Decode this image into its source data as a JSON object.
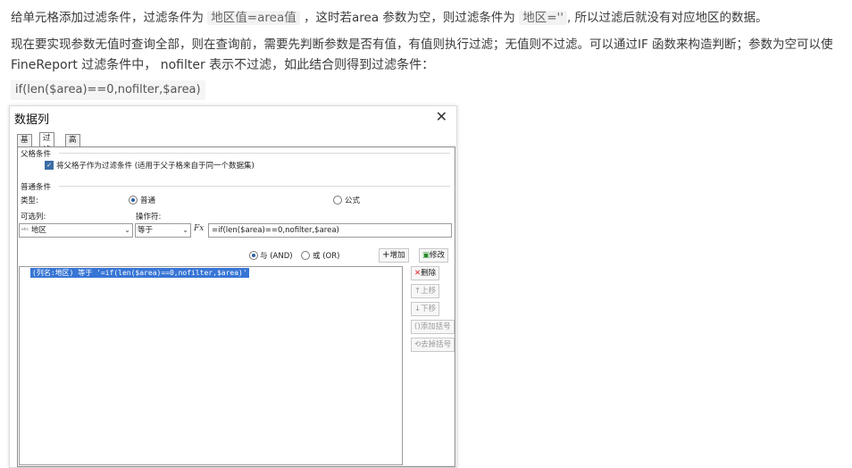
{
  "article": {
    "line1_a": "给单元格添加过滤条件，过滤条件为 ",
    "line1_code1": "地区值=area值",
    "line1_b": " ，这时若area 参数为空，则过滤条件为 ",
    "line1_code2": "地区=''",
    "line1_c": ", 所以过滤后就没有对应地区的数据。",
    "line2": "现在要实现参数无值时查询全部，则在查询前，需要先判断参数是否有值，有值则执行过滤；无值则不过滤。可以通过IF 函数来构造判断；参数为空可以使",
    "line3": "FineReport 过滤条件中， nofilter 表示不过滤，如此结合则得到过滤条件：",
    "code": "if(len($area)==0,nofilter,$area)"
  },
  "dialog": {
    "title": "数据列",
    "close_icon": "close-icon",
    "tabs": [
      {
        "label": "基本"
      },
      {
        "label": "过滤",
        "active": true
      },
      {
        "label": "高级"
      }
    ],
    "parent_group": {
      "label": "父格条件",
      "checkbox_label": "将父格子作为过滤条件 (适用于父子格来自于同一个数据集)",
      "checked": true
    },
    "normal_group": {
      "label": "普通条件",
      "type_label": "类型:",
      "radio_normal": "普通",
      "radio_formula": "公式",
      "columns_label": "可选列:",
      "operator_label": "操作符:",
      "column_value": "地区",
      "column_icon": "abc-field-icon",
      "operator_value": "等于",
      "fx_label": "Fx",
      "formula_value": "=if(len($area)==0,nofilter,$area)"
    },
    "logic": {
      "and_label": "与 (AND)",
      "or_label": "或 (OR)",
      "selected": "AND"
    },
    "buttons": {
      "add": "增加",
      "modify": "修改",
      "delete": "删除",
      "up": "上移",
      "down": "下移",
      "add_bracket": "添加括号",
      "remove_bracket": "去掉括号"
    },
    "conditions": [
      "(列名:地区) 等于 '=if(len($area)==0,nofilter,$area)'"
    ]
  }
}
